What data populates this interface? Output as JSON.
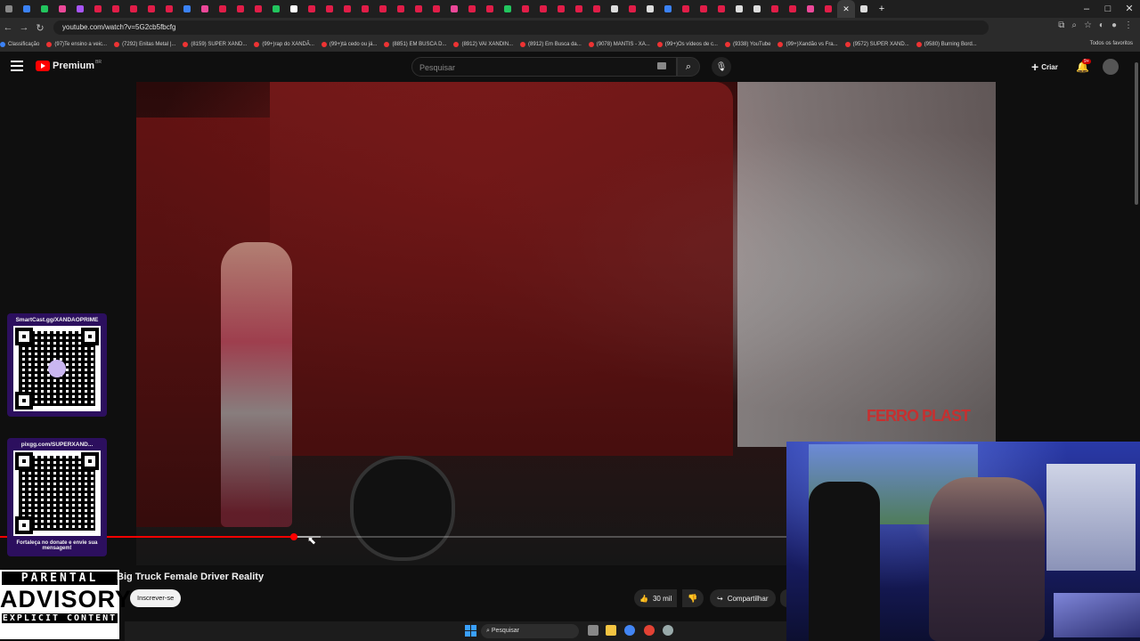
{
  "browser": {
    "url": "youtube.com/watch?v=5G2cb5fbcfg",
    "bookmarks": [
      "Classificação",
      "(97)Te ensino a veic...",
      "(7292) Enitas Metal |...",
      "(8159) SUPER XAND...",
      "(99+)rap do XANDÃ...",
      "(99+)tá cedo ou já...",
      "(8851) EM BUSCA D...",
      "(8912) VAI XANDIN...",
      "(8912) Em Busca da...",
      "(9078) MANTIS - XA...",
      "(99+)Os vídeos de c...",
      "(9338) YouTube",
      "(99+)Xandão vs Fra...",
      "(9572) SUPER XAND...",
      "(9580) Burning Bord..."
    ],
    "bookmarks_other": "Todos os favoritos",
    "window_controls": [
      "–",
      "□",
      "✕"
    ]
  },
  "header": {
    "logo_text": "Premium",
    "logo_region": "BR",
    "search_placeholder": "Pesquisar",
    "create_label": "Criar",
    "notifications_badge": "9+"
  },
  "video": {
    "title": "Big Truck Female Driver Reality",
    "progress": 0.183,
    "buffered": 0.215,
    "sign_text": "FERRO PLAST"
  },
  "overlays": {
    "qr1_title": "SmartCast.gg/XANDAOPRIME",
    "qr2_title": "pixgg.com/SUPERXAND...",
    "qr2_sub": "Fortaleça no donate e envie sua mensagem!",
    "advisory_top": "PARENTAL",
    "advisory_mid": "ADVISORY",
    "advisory_bot": "EXPLICIT CONTENT"
  },
  "actions": {
    "subscribe_label": "Inscrever-se",
    "likes_count": "30 mil",
    "share_label": "Compartilhar"
  },
  "taskbar": {
    "search_label": "Pesquisar"
  },
  "colors": {
    "brand_red": "#ff0000",
    "qr_card_bg": "#2c0f5e"
  }
}
